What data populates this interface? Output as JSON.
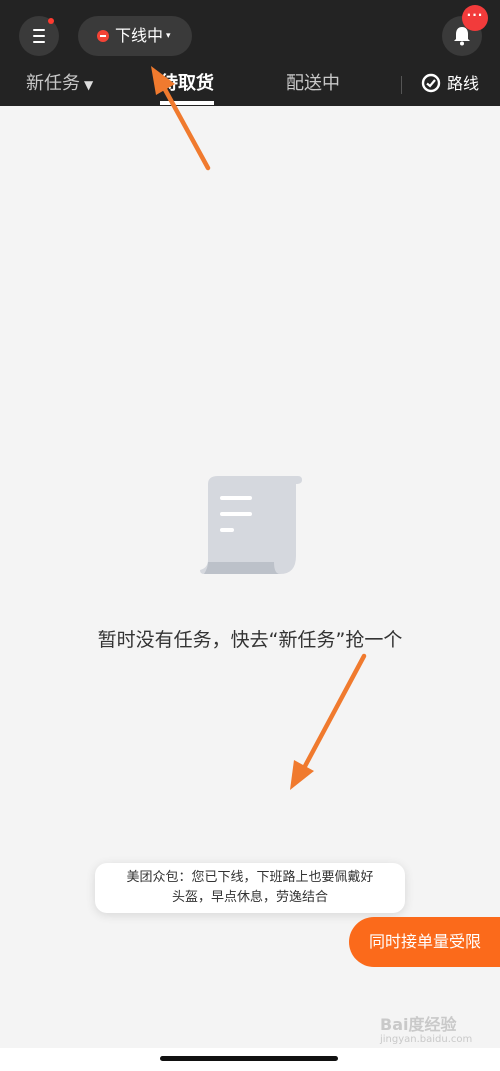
{
  "header": {
    "status_label": "下线中",
    "status_caret": "▾",
    "bell_badge": "···"
  },
  "tabs": [
    {
      "label": "新任务",
      "filter_icon": "▼"
    },
    {
      "label": "待取货"
    },
    {
      "label": "配送中"
    }
  ],
  "route": {
    "label": "路线"
  },
  "empty_state": {
    "message": "暂时没有任务，快去“新任务”抢一个"
  },
  "toast": {
    "line1": "美团众包：您已下线，下班路上也要佩戴好",
    "line2": "头盔，早点休息，劳逸结合"
  },
  "floating_button": {
    "label": "同时接单量受限"
  },
  "watermark": {
    "main": "Bai度经验",
    "sub": "jingyan.baidu.com"
  },
  "colors": {
    "header_bg": "#232323",
    "accent_orange": "#fb6a1b",
    "status_red": "#f44336"
  }
}
